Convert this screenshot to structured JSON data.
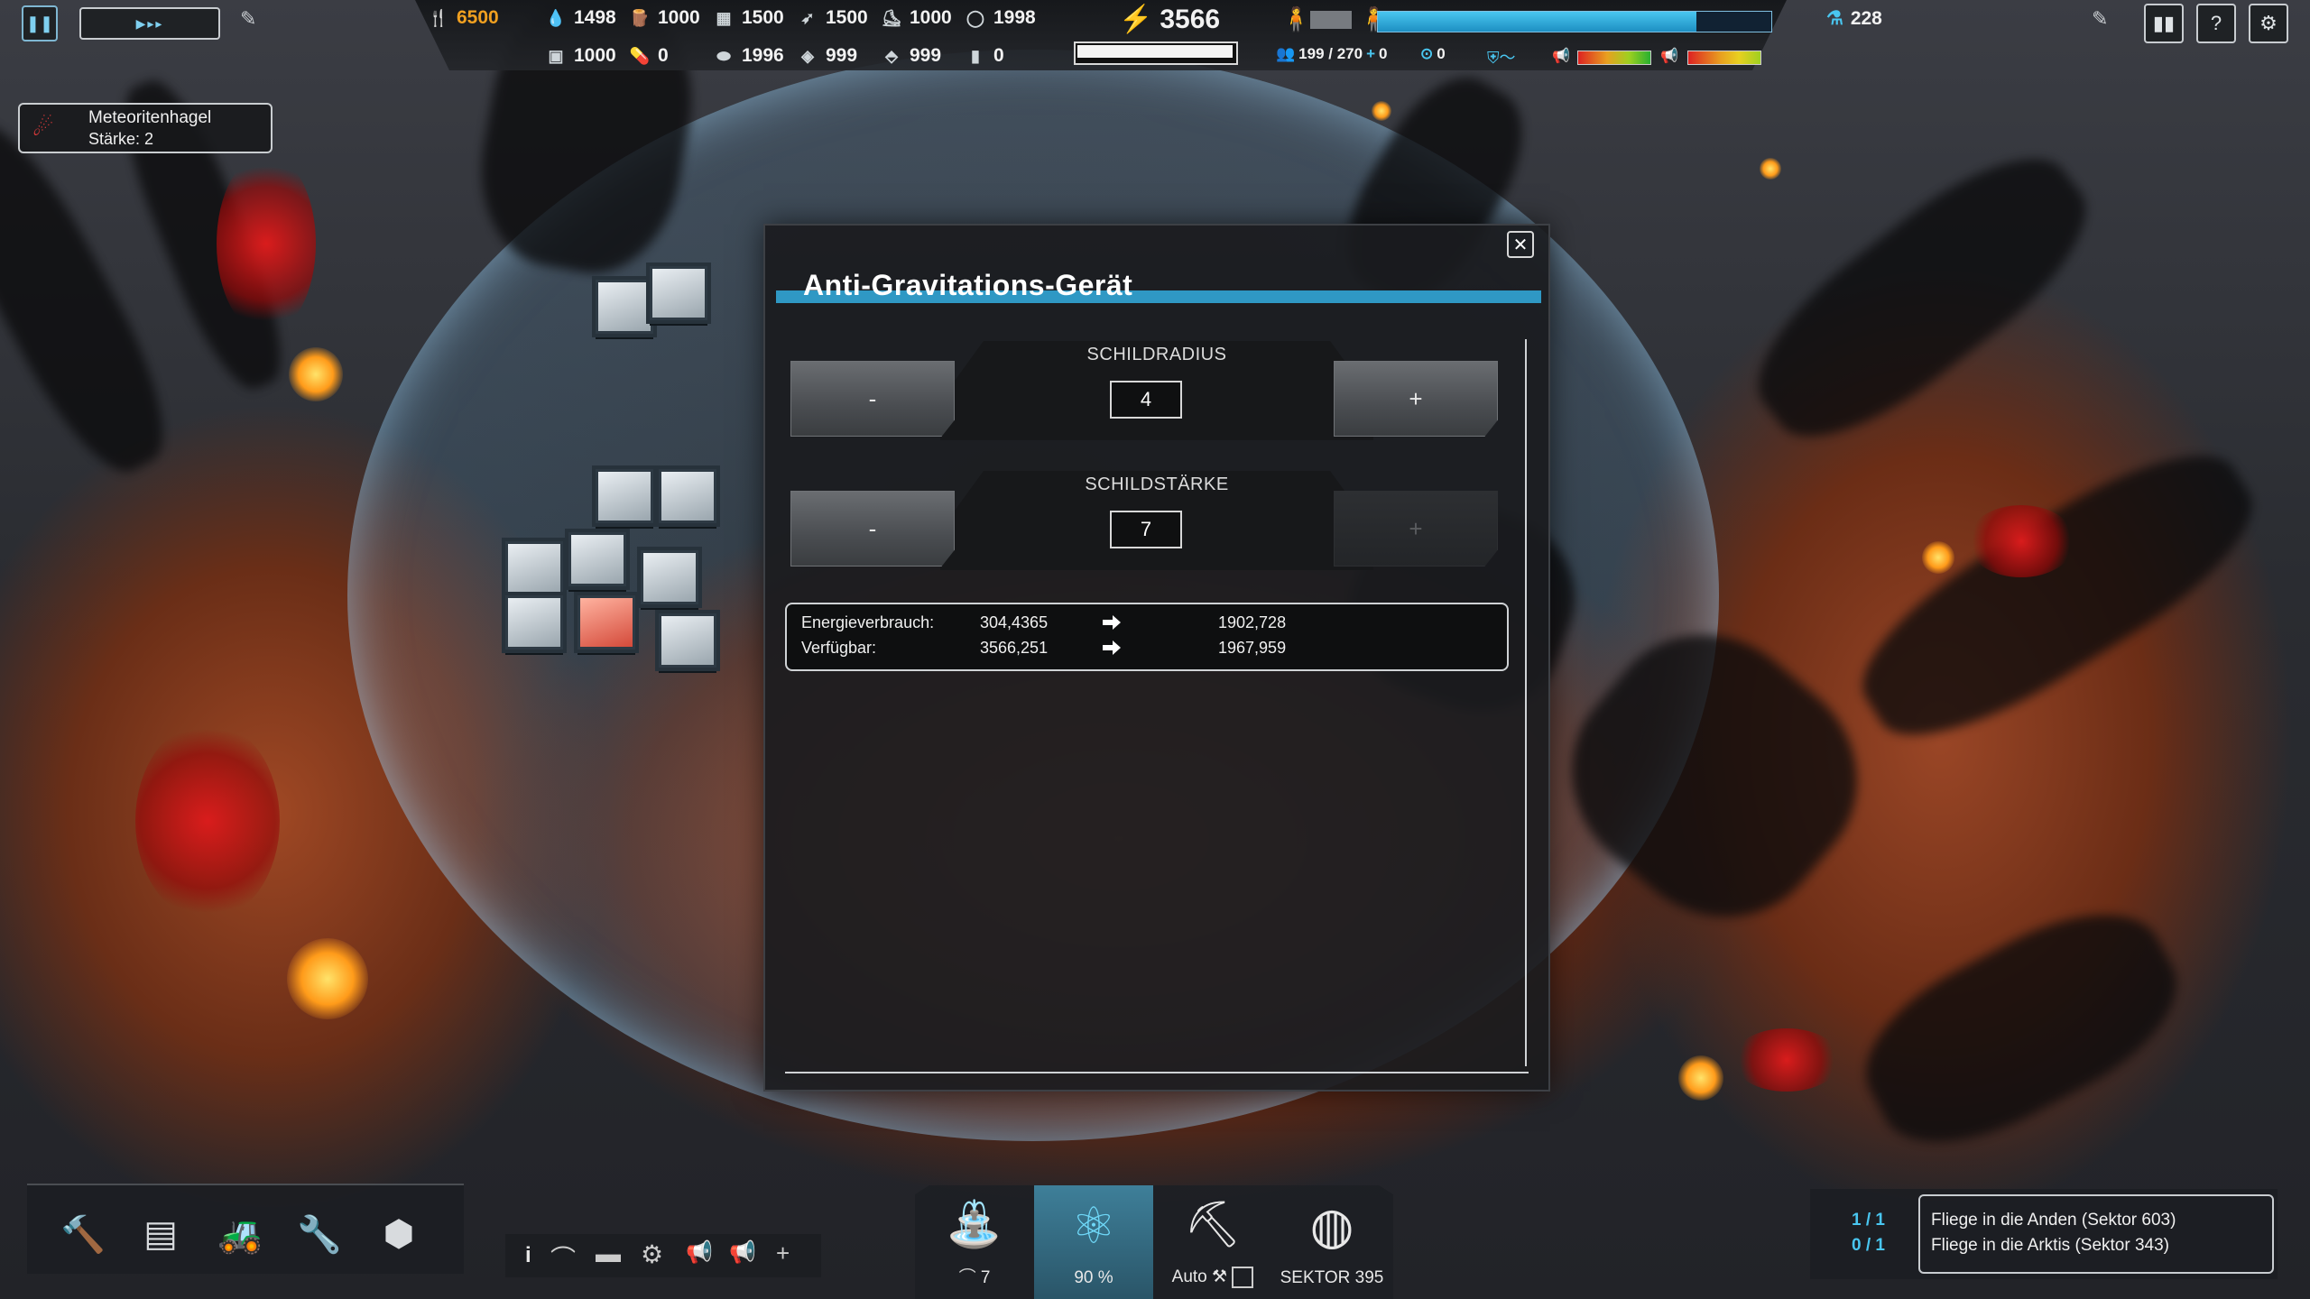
{
  "colors": {
    "accent": "#2f98c4",
    "bolt": "#f0b020",
    "food": "#f0a020"
  },
  "event": {
    "title": "Meteoritenhagel",
    "strength": "Stärke: 2",
    "icon": "meteor-icon"
  },
  "topbar": {
    "food": "6500",
    "row1": [
      {
        "icon": "water-icon",
        "value": "1498"
      },
      {
        "icon": "wood-icon",
        "value": "1000"
      },
      {
        "icon": "document-icon",
        "value": "1500"
      },
      {
        "icon": "feather-icon",
        "value": "1500"
      },
      {
        "icon": "boot-icon",
        "value": "1000"
      },
      {
        "icon": "stone-icon",
        "value": "1998"
      }
    ],
    "row2": [
      {
        "icon": "building-icon",
        "value": "1000"
      },
      {
        "icon": "medicine-icon",
        "value": "0"
      },
      {
        "icon": "metal-icon",
        "value": "1996"
      },
      {
        "icon": "ore-icon",
        "value": "999"
      },
      {
        "icon": "gold-icon",
        "value": "999"
      },
      {
        "icon": "bottle-icon",
        "value": "0"
      }
    ],
    "energy": "3566",
    "population": "199 / 270",
    "population_plus": "0",
    "unemployed": "0",
    "research": "228",
    "population_fill": 0.81
  },
  "dialog": {
    "title": "Anti-Gravitations-Gerät",
    "close": "✕",
    "radius_label": "SCHILDRADIUS",
    "radius_value": "4",
    "strength_label": "SCHILDSTÄRKE",
    "strength_value": "7",
    "minus": "-",
    "plus": "+",
    "stats": {
      "consumption_label": "Energieverbrauch:",
      "consumption_now": "304,4365",
      "consumption_new": "1902,728",
      "available_label": "Verfügbar:",
      "available_now": "3566,251",
      "available_new": "1967,959"
    }
  },
  "tools": {
    "icons": [
      "hammer-icon",
      "blueprint-icon",
      "bulldozer-icon",
      "wrench-icon",
      "stop-icon"
    ]
  },
  "minibar": {
    "info": "i",
    "plus": "+"
  },
  "modes": [
    {
      "icon": "shield-tower-icon",
      "label": "7"
    },
    {
      "icon": "atom-icon",
      "label": "90 %"
    },
    {
      "icon": "pickaxe-icon",
      "label": "Auto"
    },
    {
      "icon": "globe-icon",
      "label": "SEKTOR 395"
    }
  ],
  "quests": {
    "counts": [
      "1 / 1",
      "0 / 1"
    ],
    "items": [
      "Fliege in die Anden (Sektor 603)",
      "Fliege in die Arktis (Sektor 343)"
    ]
  }
}
